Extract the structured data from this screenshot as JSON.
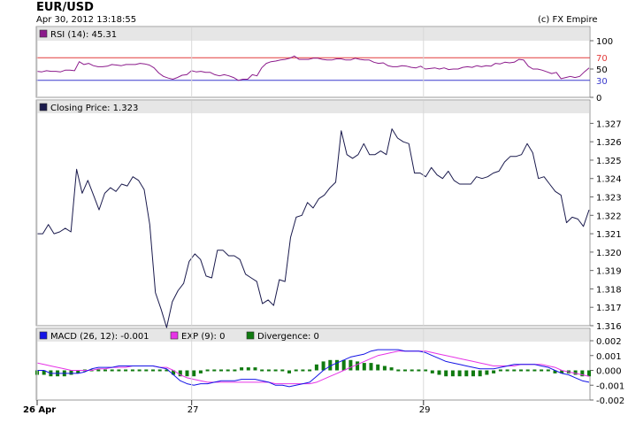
{
  "header": {
    "title": "EUR/USD",
    "datetime": "Apr 30, 2012 13:18:55",
    "credit": "(c) FX Empire"
  },
  "colors": {
    "panel_header_bg": "#e6e6e6",
    "rsi_line": "#8b1a8b",
    "rsi_upper_band": "#e23b3b",
    "rsi_lower_band": "#3a3acd",
    "price_line": "#1a1a4d",
    "macd_line": "#1414e6",
    "exp_line": "#e633e6",
    "divergence_bars": "#107a10"
  },
  "rsi_panel": {
    "legend": "RSI (14): 45.31",
    "legend_swatch_color": "#8b1a8b",
    "upper_band_label": "70",
    "lower_band_label": "30"
  },
  "price_panel": {
    "legend": "Closing Price: 1.323",
    "legend_swatch_color": "#1a1a4d"
  },
  "macd_panel": {
    "legend_macd": "MACD (26, 12): -0.001",
    "legend_exp": "EXP (9): 0",
    "legend_div": "Divergence: 0"
  },
  "chart_data": [
    {
      "type": "line",
      "panel": "rsi",
      "series": [
        {
          "name": "RSI (14)",
          "values": [
            46,
            45,
            47,
            46,
            46,
            45,
            48,
            48,
            47,
            63,
            58,
            60,
            56,
            54,
            54,
            55,
            58,
            57,
            56,
            58,
            58,
            58,
            60,
            59,
            57,
            52,
            43,
            37,
            34,
            32,
            35,
            39,
            40,
            47,
            45,
            46,
            44,
            44,
            40,
            38,
            40,
            38,
            35,
            30,
            32,
            32,
            40,
            38,
            52,
            60,
            63,
            64,
            66,
            67,
            69,
            73,
            67,
            67,
            67,
            69,
            69,
            67,
            66,
            66,
            68,
            68,
            66,
            66,
            69,
            67,
            66,
            66,
            62,
            60,
            61,
            56,
            54,
            54,
            56,
            55,
            53,
            52,
            55,
            50,
            51,
            52,
            50,
            52,
            49,
            50,
            50,
            53,
            54,
            53,
            56,
            54,
            56,
            55,
            60,
            59,
            62,
            61,
            62,
            67,
            66,
            55,
            50,
            50,
            48,
            45,
            42,
            44,
            33,
            35,
            37,
            35,
            37,
            45,
            52
          ]
        }
      ],
      "y_ticks": [
        0,
        50,
        100
      ],
      "reference_lines": [
        70,
        30
      ],
      "ylim": [
        0,
        100
      ]
    },
    {
      "type": "line",
      "panel": "price",
      "series": [
        {
          "name": "Closing Price",
          "values": [
            1.321,
            1.321,
            1.3215,
            1.321,
            1.3211,
            1.3213,
            1.3211,
            1.3245,
            1.3232,
            1.3239,
            1.3231,
            1.3223,
            1.3232,
            1.3235,
            1.3233,
            1.3237,
            1.3236,
            1.3241,
            1.3239,
            1.3234,
            1.3215,
            1.3178,
            1.3169,
            1.3159,
            1.3173,
            1.3179,
            1.3183,
            1.3195,
            1.3199,
            1.3196,
            1.3187,
            1.3186,
            1.3201,
            1.3201,
            1.3198,
            1.3198,
            1.3196,
            1.3188,
            1.3186,
            1.3184,
            1.3172,
            1.3174,
            1.3171,
            1.3185,
            1.3184,
            1.3208,
            1.3219,
            1.322,
            1.3227,
            1.3224,
            1.3229,
            1.3231,
            1.3235,
            1.3238,
            1.3266,
            1.3253,
            1.3251,
            1.3253,
            1.3259,
            1.3253,
            1.3253,
            1.3255,
            1.3253,
            1.3267,
            1.3262,
            1.326,
            1.3259,
            1.3243,
            1.3243,
            1.3241,
            1.3246,
            1.3242,
            1.324,
            1.3244,
            1.3239,
            1.3237,
            1.3237,
            1.3237,
            1.3241,
            1.324,
            1.3241,
            1.3243,
            1.3244,
            1.3249,
            1.3252,
            1.3252,
            1.3253,
            1.3259,
            1.3254,
            1.324,
            1.3241,
            1.3237,
            1.3233,
            1.3231,
            1.3216,
            1.3219,
            1.3218,
            1.3214,
            1.3223
          ]
        }
      ],
      "y_ticks": [
        1.316,
        1.317,
        1.318,
        1.319,
        1.32,
        1.321,
        1.322,
        1.323,
        1.324,
        1.325,
        1.326,
        1.327
      ],
      "ylim": [
        1.316,
        1.3275
      ]
    },
    {
      "type": "line",
      "panel": "macd",
      "series": [
        {
          "name": "MACD (26, 12)",
          "values": [
            0.0,
            0.0,
            -0.0002,
            -0.0002,
            -0.0002,
            -0.0002,
            -0.0002,
            -0.0001,
            0.0001,
            0.0002,
            0.0002,
            0.0002,
            0.0003,
            0.0003,
            0.0003,
            0.0003,
            0.0003,
            0.0003,
            0.0002,
            0.0001,
            -0.0003,
            -0.0007,
            -0.0009,
            -0.001,
            -0.0009,
            -0.0009,
            -0.0008,
            -0.0007,
            -0.0007,
            -0.0007,
            -0.0006,
            -0.0006,
            -0.0006,
            -0.0007,
            -0.0008,
            -0.001,
            -0.001,
            -0.0011,
            -0.001,
            -0.0009,
            -0.0008,
            -0.0004,
            0.0,
            0.0003,
            0.0005,
            0.0007,
            0.0009,
            0.001,
            0.0011,
            0.0013,
            0.0014,
            0.0014,
            0.0014,
            0.0014,
            0.0013,
            0.0013,
            0.0013,
            0.0012,
            0.001,
            0.0008,
            0.0006,
            0.0005,
            0.0004,
            0.0003,
            0.0002,
            0.0001,
            0.0001,
            0.0001,
            0.0002,
            0.0003,
            0.0004,
            0.0004,
            0.0004,
            0.0004,
            0.0003,
            0.0002,
            0.0,
            -0.0002,
            -0.0003,
            -0.0005,
            -0.0007,
            -0.0008
          ]
        },
        {
          "name": "EXP (9)",
          "values": [
            0.0005,
            0.0004,
            0.0003,
            0.0002,
            0.0001,
            0.0,
            0.0,
            0.0,
            0.0,
            0.0001,
            0.0001,
            0.0002,
            0.0002,
            0.0002,
            0.0003,
            0.0003,
            0.0003,
            0.0003,
            0.0002,
            0.0002,
            0.0,
            -0.0003,
            -0.0005,
            -0.0006,
            -0.0007,
            -0.0008,
            -0.0008,
            -0.0008,
            -0.0008,
            -0.0008,
            -0.0008,
            -0.0008,
            -0.0008,
            -0.0008,
            -0.0008,
            -0.0009,
            -0.0009,
            -0.0009,
            -0.0009,
            -0.0009,
            -0.0009,
            -0.0008,
            -0.0006,
            -0.0004,
            -0.0002,
            0.0,
            0.0002,
            0.0004,
            0.0006,
            0.0008,
            0.001,
            0.0011,
            0.0012,
            0.0013,
            0.0013,
            0.0013,
            0.0013,
            0.0013,
            0.0012,
            0.0011,
            0.001,
            0.0009,
            0.0008,
            0.0007,
            0.0006,
            0.0005,
            0.0004,
            0.0003,
            0.0003,
            0.0003,
            0.0003,
            0.0004,
            0.0004,
            0.0004,
            0.0004,
            0.0003,
            0.0002,
            0.0,
            -0.0001,
            -0.0002,
            -0.0003,
            -0.0004
          ]
        }
      ],
      "divergence": [
        -0.0003,
        -0.0003,
        -0.0004,
        -0.0004,
        -0.0004,
        -0.0003,
        -0.0002,
        0.0,
        0.0001,
        0.0001,
        0.0001,
        0.0,
        0.0001,
        0.0001,
        0.0,
        0.0,
        0.0,
        0.0,
        0.0,
        -0.0001,
        -0.0003,
        -0.0004,
        -0.0004,
        -0.0004,
        -0.0002,
        -0.0001,
        0.0,
        0.0001,
        0.0001,
        0.0001,
        0.0002,
        0.0002,
        0.0002,
        0.0001,
        0.0,
        -0.0001,
        -0.0001,
        -0.0002,
        -0.0001,
        0.0,
        0.0001,
        0.0004,
        0.0006,
        0.0007,
        0.0007,
        0.0007,
        0.0007,
        0.0006,
        0.0005,
        0.0005,
        0.0004,
        0.0003,
        0.0002,
        0.0001,
        0.0,
        0.0,
        0.0,
        -0.0001,
        -0.0002,
        -0.0003,
        -0.0004,
        -0.0004,
        -0.0004,
        -0.0004,
        -0.0004,
        -0.0004,
        -0.0003,
        -0.0002,
        -0.0001,
        0.0,
        0.0001,
        0.0,
        0.0,
        0.0,
        -0.0001,
        -0.0001,
        -0.0002,
        -0.0002,
        -0.0002,
        -0.0003,
        -0.0004,
        -0.0004
      ],
      "y_ticks": [
        -0.002,
        -0.001,
        0.0,
        0.001,
        0.002
      ],
      "y_tick_labels": [
        "-0.002",
        "-0.001",
        "0.000",
        "0.001",
        "0.002"
      ],
      "ylim": [
        -0.002,
        0.002
      ]
    }
  ],
  "x_axis": {
    "labels": [
      "26 Apr",
      "27",
      "29"
    ],
    "positions": [
      0.0,
      0.28,
      0.7
    ]
  }
}
